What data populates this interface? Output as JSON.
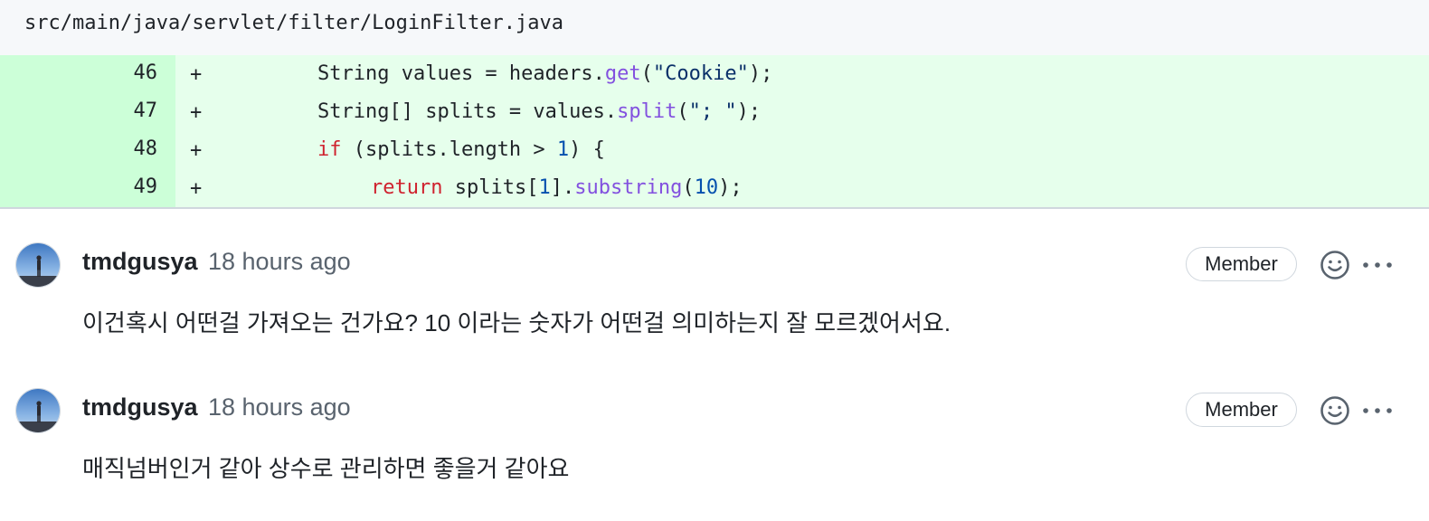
{
  "file": {
    "path": "src/main/java/servlet/filter/LoginFilter.java"
  },
  "diff": {
    "lines": [
      {
        "number": "46",
        "marker": "+",
        "tokens": [
          {
            "text": "String values = headers.",
            "kind": "plain"
          },
          {
            "text": "get",
            "kind": "fn"
          },
          {
            "text": "(",
            "kind": "plain"
          },
          {
            "text": "\"Cookie\"",
            "kind": "str"
          },
          {
            "text": ");",
            "kind": "plain"
          }
        ]
      },
      {
        "number": "47",
        "marker": "+",
        "tokens": [
          {
            "text": "String[] splits = values.",
            "kind": "plain"
          },
          {
            "text": "split",
            "kind": "fn"
          },
          {
            "text": "(",
            "kind": "plain"
          },
          {
            "text": "\"; \"",
            "kind": "str"
          },
          {
            "text": ");",
            "kind": "plain"
          }
        ]
      },
      {
        "number": "48",
        "marker": "+",
        "tokens": [
          {
            "text": "if",
            "kind": "kw"
          },
          {
            "text": " (splits.length > ",
            "kind": "plain"
          },
          {
            "text": "1",
            "kind": "num"
          },
          {
            "text": ") {",
            "kind": "plain"
          }
        ]
      },
      {
        "number": "49",
        "marker": "+",
        "tokens": [
          {
            "text": "return",
            "kind": "kw"
          },
          {
            "text": " splits[",
            "kind": "plain"
          },
          {
            "text": "1",
            "kind": "num"
          },
          {
            "text": "].",
            "kind": "plain"
          },
          {
            "text": "substring",
            "kind": "fn"
          },
          {
            "text": "(",
            "kind": "plain"
          },
          {
            "text": "10",
            "kind": "num"
          },
          {
            "text": ");",
            "kind": "plain"
          }
        ]
      }
    ]
  },
  "comments": [
    {
      "author": "tmdgusya",
      "timestamp": "18 hours ago",
      "badge": "Member",
      "body": "이건혹시 어떤걸 가져오는 건가요? 10 이라는 숫자가 어떤걸 의미하는지 잘 모르겠어서요."
    },
    {
      "author": "tmdgusya",
      "timestamp": "18 hours ago",
      "badge": "Member",
      "body": "매직넘버인거 같아 상수로 관리하면 좋을거 같아요"
    }
  ],
  "colors": {
    "added_line_bg": "#e6ffec",
    "added_gutter_bg": "#ccffd8",
    "keyword": "#cf222e",
    "function": "#8250df",
    "string": "#0a3069",
    "number": "#0550ae"
  },
  "icons": {
    "emoji": "smiley-icon",
    "more": "kebab-horizontal-icon"
  }
}
